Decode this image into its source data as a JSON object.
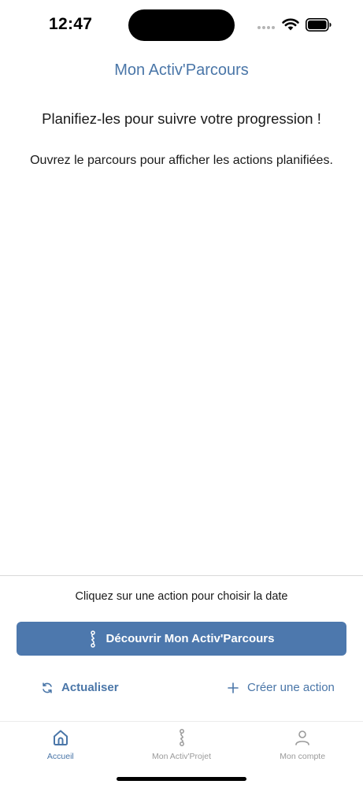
{
  "status_bar": {
    "time": "12:47"
  },
  "header": {
    "title": "Mon Activ'Parcours"
  },
  "main": {
    "subtitle": "Planifiez-les pour suivre votre progression !",
    "info": "Ouvrez le parcours pour afficher les actions planifiées."
  },
  "bottom_panel": {
    "hint": "Cliquez sur une action pour choisir la date",
    "discover_button": "Découvrir Mon Activ'Parcours",
    "refresh_label": "Actualiser",
    "create_label": "Créer une action"
  },
  "tab_bar": {
    "tabs": [
      {
        "label": "Accueil",
        "icon": "home-icon",
        "active": true
      },
      {
        "label": "Mon Activ'Projet",
        "icon": "path-icon",
        "active": false
      },
      {
        "label": "Mon compte",
        "icon": "user-icon",
        "active": false
      }
    ]
  },
  "colors": {
    "accent": "#4a76a8",
    "button": "#4d78ad",
    "inactive": "#9a9a9a"
  }
}
